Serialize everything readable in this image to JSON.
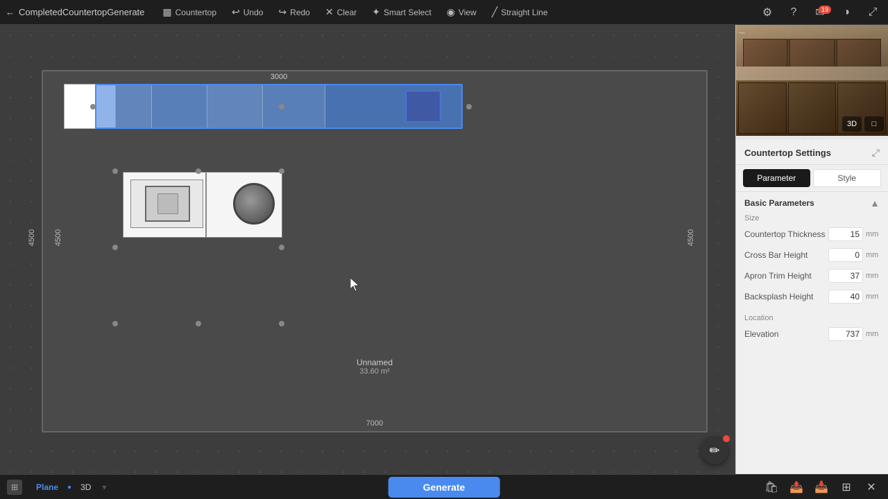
{
  "app": {
    "title": "CompletedCountertopGenerate",
    "back_icon": "←"
  },
  "toolbar": {
    "countertop_label": "Countertop",
    "undo_label": "Undo",
    "redo_label": "Redo",
    "clear_label": "Clear",
    "smart_select_label": "Smart Select",
    "view_label": "View",
    "straight_line_label": "Straight Line"
  },
  "topbar_icons": {
    "settings": "⚙",
    "help": "?",
    "messages": "✉",
    "badge": "19",
    "palette": "🎨",
    "fullscreen": "⛶"
  },
  "canvas": {
    "dimensions": {
      "top": "3000",
      "bottom": "7000",
      "left": "4500",
      "right": "4500"
    },
    "room_name": "Unnamed",
    "room_size": "33.60 m²"
  },
  "side_panel": {
    "countertop_settings_title": "Countertop Settings",
    "expand_icon": "⤢",
    "tabs": [
      {
        "label": "Parameter",
        "active": true
      },
      {
        "label": "Style",
        "active": false
      }
    ],
    "basic_parameters_title": "Basic Parameters",
    "size_section": "Size",
    "parameters": [
      {
        "label": "Countertop Thickness",
        "value": "15",
        "unit": "mm"
      },
      {
        "label": "Cross Bar Height",
        "value": "0",
        "unit": "mm"
      },
      {
        "label": "Apron Trim Height",
        "value": "37",
        "unit": "mm"
      },
      {
        "label": "Backsplash Height",
        "value": "40",
        "unit": "mm"
      }
    ],
    "location_section": "Location",
    "location_params": [
      {
        "label": "Elevation",
        "value": "737",
        "unit": "mm"
      }
    ]
  },
  "bottombar": {
    "view_plane_label": "Plane",
    "view_3d_label": "3D",
    "generate_label": "Generate"
  },
  "icons": {
    "countertop": "▦",
    "undo": "↩",
    "redo": "↪",
    "clear": "✕",
    "smart_select": "⊹",
    "view": "◉",
    "straight_line": "╱",
    "settings": "⚙",
    "help": "?",
    "palette": "◑",
    "fullscreen": "⤢",
    "chat": "✏",
    "save": "🛍",
    "export1": "📤",
    "export2": "📥",
    "share": "⊞",
    "close": "✕"
  }
}
